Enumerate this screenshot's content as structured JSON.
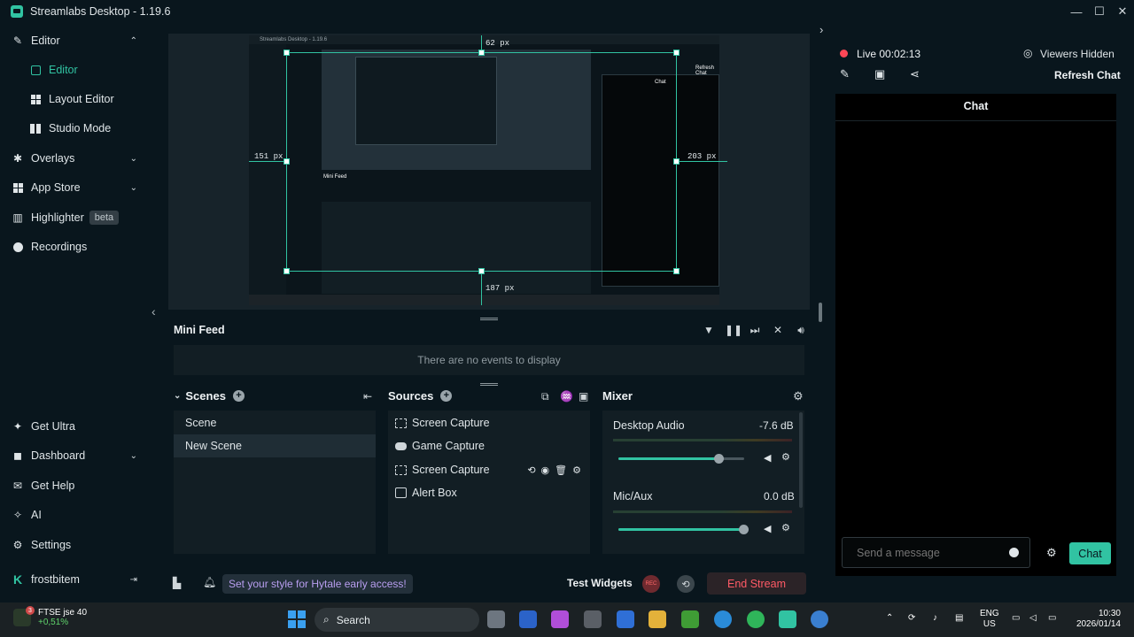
{
  "window": {
    "title": "Streamlabs Desktop - 1.19.6",
    "controls": [
      "—",
      "☐",
      "✕"
    ]
  },
  "sidebar": {
    "items": [
      {
        "label": "Editor",
        "icon": "editor-icon"
      },
      {
        "label": "Editor",
        "icon": "editor-square-icon",
        "active": true
      },
      {
        "label": "Layout Editor",
        "icon": "layout-grid-icon"
      },
      {
        "label": "Studio Mode",
        "icon": "studio-mode-icon"
      },
      {
        "label": "Overlays",
        "icon": "overlays-icon"
      },
      {
        "label": "App Store",
        "icon": "app-store-icon"
      },
      {
        "label": "Highlighter",
        "icon": "highlighter-icon",
        "badge": "beta"
      },
      {
        "label": "Recordings",
        "icon": "recordings-icon"
      }
    ],
    "bottom": [
      {
        "label": "Get Ultra",
        "icon": "ultra-icon"
      },
      {
        "label": "Dashboard",
        "icon": "dashboard-icon"
      },
      {
        "label": "Get Help",
        "icon": "help-icon"
      },
      {
        "label": "AI",
        "icon": "ai-icon"
      },
      {
        "label": "Settings",
        "icon": "gear-icon"
      },
      {
        "label": "frostbitem",
        "icon": "kick-icon"
      }
    ]
  },
  "preview": {
    "dims": {
      "top": "62 px",
      "left": "151 px",
      "right": "203 px",
      "bottom": "187 px"
    },
    "mini_title": "Streamlabs Desktop - 1.19.6",
    "mini_feed": "Mini Feed",
    "mini_chat": "Chat",
    "mini_refresh": "Refresh Chat"
  },
  "minifeed": {
    "title": "Mini Feed",
    "empty": "There are no events to display"
  },
  "scenes": {
    "title": "Scenes",
    "items": [
      {
        "name": "Scene"
      },
      {
        "name": "New Scene",
        "selected": true
      }
    ]
  },
  "sources": {
    "title": "Sources",
    "items": [
      {
        "name": "Screen Capture",
        "icon": "screen-capture-icon"
      },
      {
        "name": "Game Capture",
        "icon": "gamepad-icon"
      },
      {
        "name": "Screen Capture",
        "icon": "screen-capture-icon",
        "hover": true
      },
      {
        "name": "Alert Box",
        "icon": "alert-box-icon"
      }
    ]
  },
  "mixer": {
    "title": "Mixer",
    "channels": [
      {
        "name": "Desktop Audio",
        "db": "-7.6 dB",
        "level": 0.8
      },
      {
        "name": "Mic/Aux",
        "db": "0.0 dB",
        "level": 1.0
      }
    ]
  },
  "footer": {
    "promo": "Set your style for Hytale early access!",
    "test_widgets": "Test Widgets",
    "rec": "REC",
    "end_stream": "End Stream"
  },
  "chat": {
    "live": "Live 00:02:13",
    "viewers_hidden": "Viewers Hidden",
    "refresh": "Refresh Chat",
    "title": "Chat",
    "placeholder": "Send a message",
    "send": "Chat"
  },
  "taskbar": {
    "stock_name": "FTSE jse 40",
    "stock_change": "+0,51%",
    "stock_badge": "3",
    "search": "Search",
    "lang1": "ENG",
    "lang2": "US",
    "time": "10:30",
    "date": "2026/01/14"
  },
  "colors": {
    "accent": "#31c3a2",
    "live": "#ff4756",
    "end_stream": "#ff5a66",
    "bg": "#09161d",
    "panel": "#121e24"
  }
}
